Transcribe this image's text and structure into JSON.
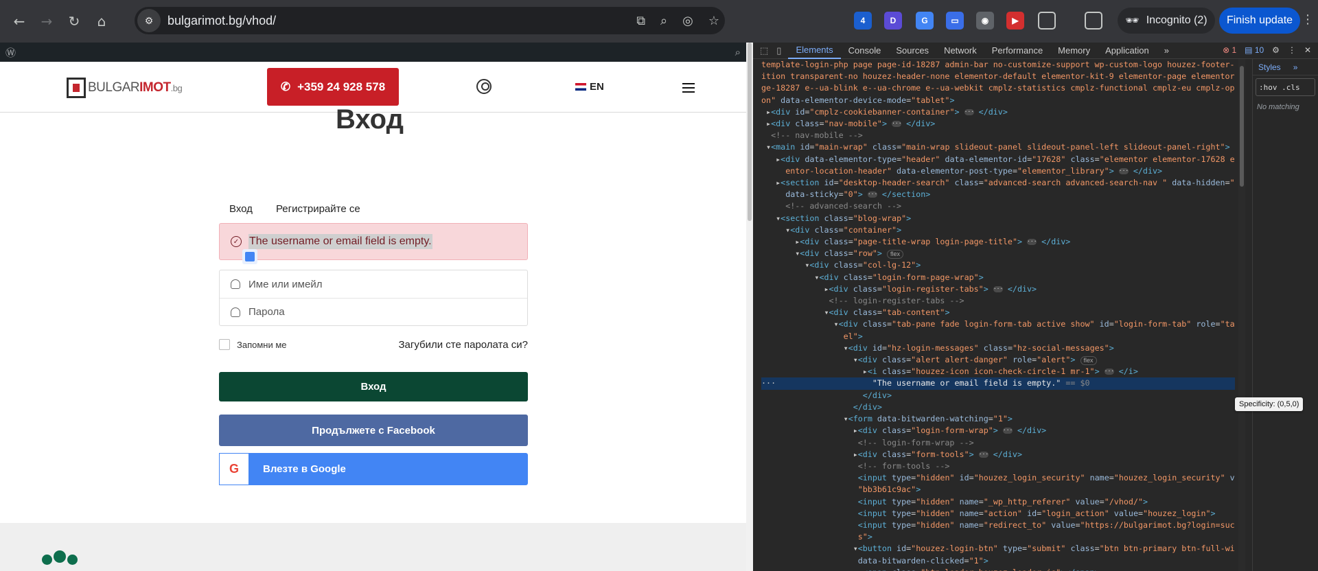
{
  "browser": {
    "url": "bulgarimot.bg/vhod/",
    "incognito_label": "Incognito (2)",
    "finish_update_label": "Finish update",
    "ext_badge": "4"
  },
  "site": {
    "logo_main": "BULGAR",
    "logo_bold": "IMOT",
    "logo_suffix": ".bg",
    "phone": "+359 24 928 578",
    "lang": "EN",
    "page_title": "Вход",
    "tab_login": "Вход",
    "tab_register": "Регистрирайте се",
    "alert_text": "The username or email field is empty.",
    "username_placeholder": "Име или имейл",
    "password_placeholder": "Парола",
    "remember_label": "Запомни ме",
    "forgot_label": "Загубили сте паролата си?",
    "login_button": "Вход",
    "facebook_button": "Продължете с Facebook",
    "google_button": "Влезте в Google"
  },
  "devtools": {
    "tabs": [
      "Elements",
      "Console",
      "Sources",
      "Network",
      "Performance",
      "Memory",
      "Application"
    ],
    "error_count": "1",
    "message_count": "10",
    "styles_tab": "Styles",
    "filter_text": ":hov .cls",
    "no_matching": "No matching",
    "specificity_tooltip": "Specificity: (0,5,0)"
  },
  "colors": {
    "phone_red": "#c81f27",
    "login_green": "#0b4733",
    "facebook_blue": "#4e69a2",
    "google_blue": "#4285f4",
    "alert_bg": "#f8d7da"
  }
}
